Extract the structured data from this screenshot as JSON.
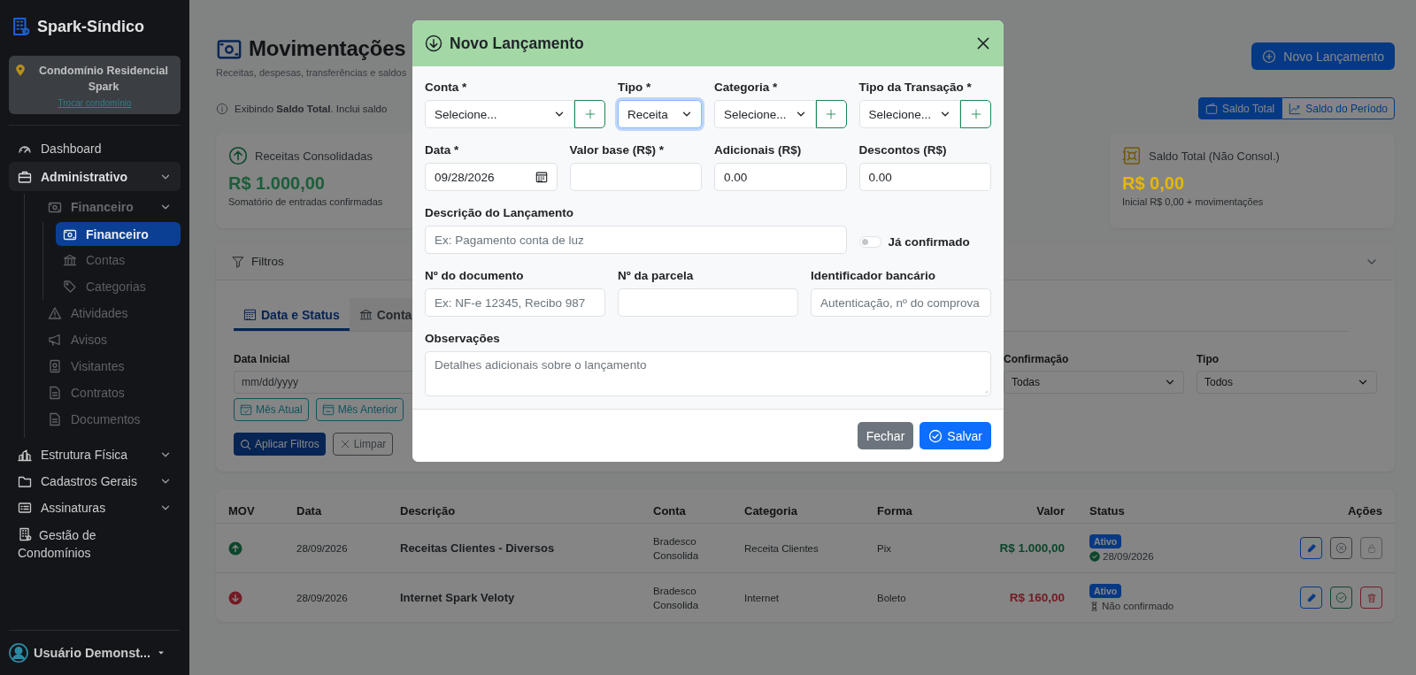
{
  "sidebar": {
    "brand": "Spark-Síndico",
    "condo": {
      "name": "Condomínio Residencial Spark",
      "link": "Trocar condomínio"
    },
    "items": [
      {
        "label": "Dashboard",
        "selected": false
      },
      {
        "label": "Administrativo",
        "selected": false,
        "expanded": true,
        "children": [
          {
            "label": "Financeiro",
            "selected": false,
            "expanded": true,
            "children": [
              {
                "label": "Financeiro",
                "selected": true
              },
              {
                "label": "Contas",
                "selected": false
              },
              {
                "label": "Categorias",
                "selected": false
              }
            ]
          },
          {
            "label": "Atividades",
            "selected": false
          },
          {
            "label": "Avisos",
            "selected": false
          },
          {
            "label": "Visitantes",
            "selected": false
          },
          {
            "label": "Contratos",
            "selected": false
          },
          {
            "label": "Documentos",
            "selected": false
          }
        ]
      },
      {
        "label": "Estrutura Física",
        "selected": false,
        "expanded": false
      },
      {
        "label": "Cadastros Gerais",
        "selected": false,
        "expanded": false
      },
      {
        "label": "Assinaturas",
        "selected": false,
        "expanded": false
      },
      {
        "label": "Gestão de Condomínios",
        "selected": false
      }
    ],
    "user": "Usuário Demonst..."
  },
  "page": {
    "title": "Movimentações",
    "subtitle": "Receitas, despesas, transferências e saldos",
    "new_button": "Novo Lançamento",
    "info": "Exibindo **Saldo Total**. Inclui saldo",
    "balance_modes": [
      {
        "label": "Saldo Total",
        "selected": true
      },
      {
        "label": "Saldo do Período",
        "selected": false
      }
    ],
    "cards": [
      {
        "kind": "income",
        "title": "Receitas Consolidadas",
        "value": "R$ 1.000,00",
        "note": "Somatório de entradas confirmadas",
        "color": "#1b5e3a"
      },
      {
        "kind": "balance",
        "title": "Saldo Total (Não Consol.)",
        "value": "R$ 0,00",
        "note": "Inicial R$ 0,00 + movimentações",
        "color": "#e6b800"
      }
    ],
    "filters": {
      "title": "Filtros",
      "expanded": true,
      "tabs": [
        {
          "label": "Data e Status",
          "selected": true
        },
        {
          "label": "Conta",
          "selected": false
        }
      ],
      "start_date": {
        "label": "Data Inicial",
        "placeholder": "mm/dd/yyyy"
      },
      "quick": [
        "Mês Atual",
        "Mês Anterior"
      ],
      "apply": "Aplicar Filtros",
      "clear": "Limpar",
      "selects": [
        {
          "label": "Confirmação",
          "value": "Todas"
        },
        {
          "label": "Tipo",
          "value": "Todos"
        }
      ]
    },
    "table": {
      "columns": [
        "MOV",
        "Data",
        "Descrição",
        "Conta",
        "Categoria",
        "Forma",
        "Valor",
        "Status",
        "Ações"
      ],
      "rows": [
        {
          "kind": "income",
          "date": "28/09/2026",
          "description": "Receitas Clientes - Diversos",
          "account": "Bradesco",
          "account_note": "Consolida",
          "category": "Receita Clientes",
          "method": "Pix",
          "value": "R$ 1.000,00",
          "status": "Ativo",
          "confirmed": true,
          "confirmation": "28/09/2026"
        },
        {
          "kind": "expense",
          "date": "28/09/2026",
          "description": "Internet Spark Veloty",
          "account": "Bradesco",
          "account_note": "Consolida",
          "category": "Internet",
          "method": "Boleto",
          "value": "R$ 160,00",
          "status": "Ativo",
          "confirmed": false,
          "confirmation": "Não confirmado"
        }
      ]
    }
  },
  "modal": {
    "title": "Novo Lançamento",
    "fields": [
      {
        "kind": "select",
        "label": "Conta *",
        "value": "Selecione...",
        "add": true,
        "focused": false
      },
      {
        "kind": "select",
        "label": "Tipo *",
        "value": "Receita",
        "focused": true
      },
      {
        "kind": "select",
        "label": "Categoria *",
        "value": "Selecione...",
        "add": true,
        "focused": false
      },
      {
        "kind": "select",
        "label": "Tipo da Transação *",
        "value": "Selecione...",
        "add": true,
        "focused": false
      },
      {
        "kind": "date",
        "label": "Data *",
        "value": "09/28/2026"
      },
      {
        "kind": "input",
        "label": "Valor base (R$) *"
      },
      {
        "kind": "input",
        "label": "Adicionais (R$)",
        "value": "0.00"
      },
      {
        "kind": "input",
        "label": "Descontos (R$)",
        "value": "0.00"
      },
      {
        "kind": "input",
        "label": "Descrição do Lançamento",
        "placeholder": "Ex: Pagamento conta de luz"
      },
      {
        "kind": "toggle",
        "label": "Já confirmado",
        "on": false
      },
      {
        "kind": "input",
        "label": "Nº do documento",
        "placeholder": "Ex: NF-e 12345, Recibo 987"
      },
      {
        "kind": "input",
        "label": "Nº da parcela"
      },
      {
        "kind": "input",
        "label": "Identificador bancário",
        "placeholder": "Autenticação, nº do comprova"
      },
      {
        "kind": "textarea",
        "label": "Observações",
        "placeholder": "Detalhes adicionais sobre o lançamento"
      }
    ],
    "buttons": [
      {
        "kind": "secondary",
        "label": "Fechar"
      },
      {
        "kind": "primary",
        "label": "Salvar"
      }
    ]
  }
}
